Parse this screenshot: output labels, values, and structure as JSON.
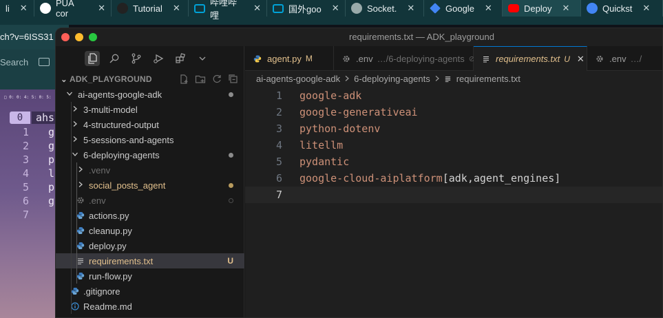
{
  "browser": {
    "tabs": [
      {
        "label": "li",
        "icon": "app-icon",
        "color": "#555"
      },
      {
        "label": "PUA cor",
        "icon": "github-icon",
        "color": "#ffffff"
      },
      {
        "label": "Tutorial",
        "icon": "page-icon",
        "color": "#222"
      },
      {
        "label": "哔哩哔哩",
        "icon": "bilibili-icon",
        "color": "#00a1d6"
      },
      {
        "label": "国外goo",
        "icon": "bilibili-icon",
        "color": "#00a1d6"
      },
      {
        "label": "Socket.",
        "icon": "globe-icon",
        "color": "#9aa"
      },
      {
        "label": "Google",
        "icon": "gemini-icon",
        "color": "#4285f4"
      },
      {
        "label": "Deploy",
        "icon": "youtube-icon",
        "color": "#ff0000"
      },
      {
        "label": "Quickst",
        "icon": "gcloud-icon",
        "color": "#4285f4"
      }
    ],
    "url_fragment": "ch?v=6ISS31",
    "search_label": "Search"
  },
  "terminal": {
    "status_line": "□ 0: 0: 4: 5: 0: 5:",
    "badge": "0",
    "session": "ahs",
    "lines": [
      {
        "n": "1",
        "c": "g"
      },
      {
        "n": "2",
        "c": "g"
      },
      {
        "n": "3",
        "c": "p"
      },
      {
        "n": "4",
        "c": "l"
      },
      {
        "n": "5",
        "c": "p"
      },
      {
        "n": "6",
        "c": "g"
      },
      {
        "n": "7",
        "c": ""
      }
    ]
  },
  "window": {
    "title": "requirements.txt — ADK_playground"
  },
  "explorer": {
    "workspace": "ADK_PLAYGROUND",
    "items": [
      {
        "label": "ai-agents-google-adk",
        "depth": 0,
        "kind": "folder-open",
        "dot": "#8b8b8b",
        "color": "#cccccc"
      },
      {
        "label": "3-multi-model",
        "depth": 1,
        "kind": "folder",
        "color": "#cccccc"
      },
      {
        "label": "4-structured-output",
        "depth": 1,
        "kind": "folder",
        "color": "#cccccc"
      },
      {
        "label": "5-sessions-and-agents",
        "depth": 1,
        "kind": "folder",
        "color": "#cccccc"
      },
      {
        "label": "6-deploying-agents",
        "depth": 1,
        "kind": "folder-open",
        "dot": "#8b8b8b",
        "color": "#cccccc"
      },
      {
        "label": ".venv",
        "depth": 2,
        "kind": "folder",
        "color": "#6e6e6e"
      },
      {
        "label": "social_posts_agent",
        "depth": 2,
        "kind": "folder",
        "dot": "#b89b5e",
        "color": "#e2c08d"
      },
      {
        "label": ".env",
        "depth": 2,
        "kind": "gear",
        "color": "#6e6e6e",
        "ignored": true
      },
      {
        "label": "actions.py",
        "depth": 2,
        "kind": "python",
        "color": "#cccccc"
      },
      {
        "label": "cleanup.py",
        "depth": 2,
        "kind": "python",
        "color": "#cccccc"
      },
      {
        "label": "deploy.py",
        "depth": 2,
        "kind": "python",
        "color": "#cccccc"
      },
      {
        "label": "requirements.txt",
        "depth": 2,
        "kind": "text",
        "color": "#e2c08d",
        "badge": "U",
        "selected": true
      },
      {
        "label": "run-flow.py",
        "depth": 2,
        "kind": "python",
        "color": "#cccccc"
      },
      {
        "label": ".gitignore",
        "depth": 1,
        "kind": "python",
        "color": "#cccccc"
      },
      {
        "label": "Readme.md",
        "depth": 1,
        "kind": "info",
        "color": "#cccccc"
      }
    ]
  },
  "editor": {
    "tabs": [
      {
        "label": "agent.py",
        "status": "M",
        "icon": "python-icon",
        "active": false
      },
      {
        "label": ".env",
        "sub": "…/6-deploying-agents",
        "icon": "gear-icon",
        "active": false,
        "ignored": true
      },
      {
        "label": "requirements.txt",
        "status": "U",
        "icon": "text-icon",
        "active": true
      },
      {
        "label": ".env",
        "sub": "…/",
        "icon": "gear-icon",
        "active": false
      }
    ],
    "breadcrumb": [
      "ai-agents-google-adk",
      "6-deploying-agents",
      "requirements.txt"
    ],
    "lines": [
      "google-adk",
      "google-generativeai",
      "python-dotenv",
      "litellm",
      "pydantic",
      "google-cloud-aiplatform[adk,agent_engines]",
      ""
    ],
    "current_line": 7,
    "colors": {
      "string": "#ce9178",
      "plain": "#d4d4d4",
      "accent": "#0078d4",
      "untracked": "#e2c08d"
    }
  }
}
